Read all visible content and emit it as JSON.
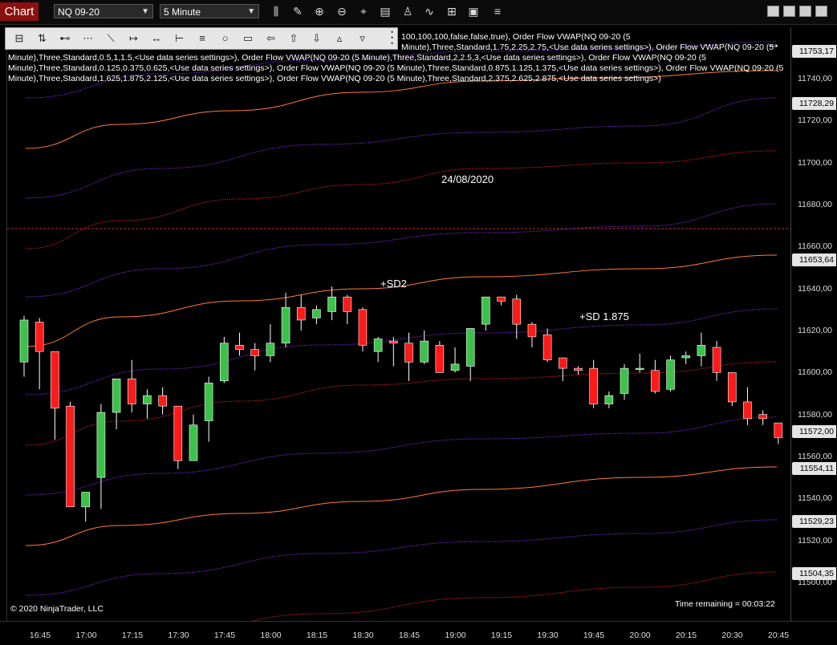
{
  "window": {
    "tab_label": "Chart",
    "instrument": "NQ 09-20",
    "timeframe": "5 Minute"
  },
  "toolbar_icons": [
    "bars-icon",
    "pencil-icon",
    "zoom-in-icon",
    "zoom-out-icon",
    "crosshair-icon",
    "chart-properties-icon",
    "strategies-icon",
    "indicators-icon",
    "chart-trader-icon",
    "snapshot-icon",
    "menu-icon"
  ],
  "draw_tools": [
    "ruler-icon",
    "risk-reward-icon",
    "line-icon",
    "extended-line-icon",
    "ray-icon",
    "arrow-line-icon",
    "horizontal-line-icon",
    "vertical-line-icon",
    "fib-icon",
    "circle-icon",
    "rectangle-icon",
    "arrow-left-icon",
    "arrow-up-icon",
    "arrow-down-icon",
    "triangle-up-icon",
    "triangle-down-icon"
  ],
  "indicator_text": {
    "line1": "100,100,100,false,false,true), Order Flow VWAP(NQ 09-20 (5",
    "line2": "Minute),Three,Standard,1.75,2.25,2.75,<Use data series settings>), Order Flow VWAP(NQ 09-20 (5",
    "line3": "Minute),Three,Standard,0.5,1,1.5,<Use data series settings>), Order Flow VWAP(NQ 09-20 (5 Minute),Three,Standard,2,2.5,3,<Use data series settings>), Order Flow VWAP(NQ 09-20 (5",
    "line4": "Minute),Three,Standard,0.125,0.375,0.625,<Use data series settings>), Order Flow VWAP(NQ 09-20 (5 Minute),Three,Standard,0.875,1.125,1.375,<Use data series settings>), Order Flow VWAP(NQ 09-20 (5",
    "line5": "Minute),Three,Standard,1.625,1.875,2.125,<Use data series settings>), Order Flow VWAP(NQ 09-20 (5 Minute),Three,Standard,2.375,2.625,2.875,<Use data series settings>)"
  },
  "annotations": {
    "date": "24/08/2020",
    "sd2": "+SD2",
    "sd1875": "+SD 1.875",
    "copyright": "© 2020 NinjaTrader, LLC",
    "time_remaining": "Time remaining = 00:03:22"
  },
  "price_ticks": [
    "11740,00",
    "11720,00",
    "11700,00",
    "11680,00",
    "11660,00",
    "11640,00",
    "11620,00",
    "11600,00",
    "11580,00",
    "11560,00",
    "11540,00",
    "11520,00",
    "11500,00"
  ],
  "price_boxes": [
    "11753,17",
    "11728,29",
    "11653,64",
    "11572,00",
    "11554,11",
    "11529,23",
    "11504,35"
  ],
  "time_ticks": [
    "16:45",
    "17:00",
    "17:15",
    "17:30",
    "17:45",
    "18:00",
    "18:15",
    "18:30",
    "18:45",
    "19:00",
    "19:15",
    "19:30",
    "19:45",
    "20:00",
    "20:15",
    "20:30",
    "20:45"
  ],
  "colors": {
    "up": "#3cc24a",
    "down": "#ff1a1a",
    "band_orange": "#ff7a3a",
    "band_red": "#d82020",
    "band_purple": "#7a2bd8",
    "date_line": "#c03030"
  },
  "chart_data": {
    "type": "candlestick",
    "y_range": [
      11497,
      11760
    ],
    "candles": [
      {
        "o": 11605,
        "h": 11627,
        "l": 11598,
        "c": 11625
      },
      {
        "o": 11624,
        "h": 11626,
        "l": 11592,
        "c": 11610
      },
      {
        "o": 11610,
        "h": 11610,
        "l": 11568,
        "c": 11583
      },
      {
        "o": 11584,
        "h": 11586,
        "l": 11536,
        "c": 11536
      },
      {
        "o": 11536,
        "h": 11540,
        "l": 11529,
        "c": 11543
      },
      {
        "o": 11550,
        "h": 11585,
        "l": 11535,
        "c": 11581
      },
      {
        "o": 11581,
        "h": 11597,
        "l": 11573,
        "c": 11597
      },
      {
        "o": 11597,
        "h": 11606,
        "l": 11581,
        "c": 11585
      },
      {
        "o": 11585,
        "h": 11592,
        "l": 11578,
        "c": 11589
      },
      {
        "o": 11589,
        "h": 11593,
        "l": 11580,
        "c": 11584
      },
      {
        "o": 11584,
        "h": 11584,
        "l": 11554,
        "c": 11558
      },
      {
        "o": 11558,
        "h": 11580,
        "l": 11558,
        "c": 11575
      },
      {
        "o": 11577,
        "h": 11598,
        "l": 11567,
        "c": 11595
      },
      {
        "o": 11596,
        "h": 11617,
        "l": 11595,
        "c": 11614
      },
      {
        "o": 11613,
        "h": 11619,
        "l": 11608,
        "c": 11611
      },
      {
        "o": 11611,
        "h": 11614,
        "l": 11601,
        "c": 11608
      },
      {
        "o": 11608,
        "h": 11623,
        "l": 11605,
        "c": 11614
      },
      {
        "o": 11614,
        "h": 11638,
        "l": 11612,
        "c": 11631
      },
      {
        "o": 11631,
        "h": 11637,
        "l": 11620,
        "c": 11625
      },
      {
        "o": 11626,
        "h": 11632,
        "l": 11623,
        "c": 11630
      },
      {
        "o": 11629,
        "h": 11641,
        "l": 11625,
        "c": 11636
      },
      {
        "o": 11636,
        "h": 11637,
        "l": 11623,
        "c": 11629
      },
      {
        "o": 11630,
        "h": 11631,
        "l": 11610,
        "c": 11613
      },
      {
        "o": 11610,
        "h": 11617,
        "l": 11605,
        "c": 11616
      },
      {
        "o": 11615,
        "h": 11617,
        "l": 11603,
        "c": 11614
      },
      {
        "o": 11614,
        "h": 11619,
        "l": 11596,
        "c": 11605
      },
      {
        "o": 11605,
        "h": 11620,
        "l": 11604,
        "c": 11615
      },
      {
        "o": 11613,
        "h": 11615,
        "l": 11600,
        "c": 11600
      },
      {
        "o": 11601,
        "h": 11612,
        "l": 11600,
        "c": 11604
      },
      {
        "o": 11603,
        "h": 11620,
        "l": 11596,
        "c": 11621
      },
      {
        "o": 11623,
        "h": 11625,
        "l": 11620,
        "c": 11636
      },
      {
        "o": 11636,
        "h": 11636,
        "l": 11632,
        "c": 11634
      },
      {
        "o": 11635,
        "h": 11637,
        "l": 11616,
        "c": 11623
      },
      {
        "o": 11623,
        "h": 11624,
        "l": 11612,
        "c": 11617
      },
      {
        "o": 11618,
        "h": 11621,
        "l": 11605,
        "c": 11606
      },
      {
        "o": 11607,
        "h": 11607,
        "l": 11596,
        "c": 11602
      },
      {
        "o": 11602,
        "h": 11603,
        "l": 11599,
        "c": 11601
      },
      {
        "o": 11602,
        "h": 11606,
        "l": 11583,
        "c": 11585
      },
      {
        "o": 11585,
        "h": 11591,
        "l": 11583,
        "c": 11589
      },
      {
        "o": 11590,
        "h": 11604,
        "l": 11587,
        "c": 11602
      },
      {
        "o": 11602,
        "h": 11609,
        "l": 11600,
        "c": 11602
      },
      {
        "o": 11601,
        "h": 11606,
        "l": 11590,
        "c": 11591
      },
      {
        "o": 11592,
        "h": 11608,
        "l": 11591,
        "c": 11606
      },
      {
        "o": 11607,
        "h": 11610,
        "l": 11604,
        "c": 11608
      },
      {
        "o": 11608,
        "h": 11619,
        "l": 11603,
        "c": 11613
      },
      {
        "o": 11612,
        "h": 11615,
        "l": 11596,
        "c": 11600
      },
      {
        "o": 11600,
        "h": 11600,
        "l": 11584,
        "c": 11586
      },
      {
        "o": 11586,
        "h": 11593,
        "l": 11575,
        "c": 11578
      },
      {
        "o": 11580,
        "h": 11582,
        "l": 11575,
        "c": 11578
      },
      {
        "o": 11576,
        "h": 11576,
        "l": 11566,
        "c": 11569
      }
    ]
  }
}
